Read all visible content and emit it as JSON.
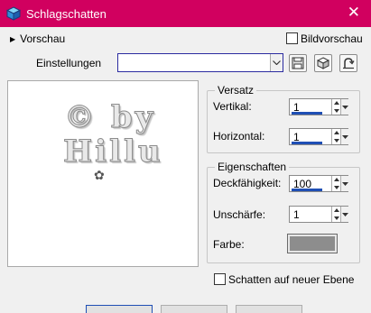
{
  "window": {
    "title": "Schlagschatten",
    "title_bar_color": "#d1005f",
    "icons": {
      "app": "plugin-cube-icon",
      "close": "close-x-icon"
    }
  },
  "preview_toggle": {
    "label": "Vorschau",
    "expanded": false
  },
  "big_preview": {
    "label": "Bildvorschau",
    "checked": false
  },
  "settings": {
    "label": "Einstellungen",
    "value": "",
    "icons": [
      "save-icon",
      "cube-3d-icon",
      "reset-icon"
    ]
  },
  "preview_image": {
    "line1": "© by",
    "line2": "Hillu",
    "mark": "✿"
  },
  "offset": {
    "title": "Versatz",
    "vertical_label": "Vertikal:",
    "vertical_value": "1",
    "horizontal_label": "Horizontal:",
    "horizontal_value": "1"
  },
  "properties": {
    "title": "Eigenschaften",
    "opacity_label": "Deckfähigkeit:",
    "opacity_value": "100",
    "blur_label": "Unschärfe:",
    "blur_value": "1",
    "color_label": "Farbe:",
    "color_value": "#8d8d8d"
  },
  "new_layer": {
    "label": "Schatten auf neuer Ebene",
    "checked": false
  },
  "colors": {
    "accent": "#1f4fb5",
    "dialog_bg": "#f0f0f0"
  }
}
